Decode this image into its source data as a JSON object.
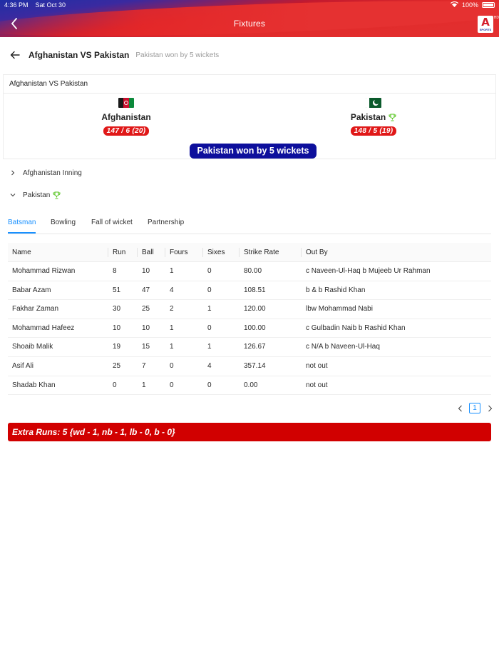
{
  "status_bar": {
    "time": "4:36 PM",
    "date": "Sat Oct 30",
    "battery": "100%"
  },
  "appbar": {
    "title": "Fixtures",
    "logo_letter": "A",
    "logo_text": "SPORTS",
    "logo_badge": "HD"
  },
  "header": {
    "title": "Afghanistan VS Pakistan",
    "subtitle": "Pakistan won by 5 wickets"
  },
  "match": {
    "title": "Afghanistan VS Pakistan",
    "team1": {
      "name": "Afghanistan",
      "score": "147 / 6 (20)"
    },
    "team2": {
      "name": "Pakistan",
      "score": "148 / 5 (19)"
    },
    "result": "Pakistan won by 5 wickets"
  },
  "innings": [
    {
      "label": "Afghanistan Inning",
      "expanded": false
    },
    {
      "label": "Pakistan",
      "expanded": true
    }
  ],
  "tabs": [
    "Batsman",
    "Bowling",
    "Fall of wicket",
    "Partnership"
  ],
  "active_tab": "Batsman",
  "table": {
    "columns": [
      "Name",
      "Run",
      "Ball",
      "Fours",
      "Sixes",
      "Strike Rate",
      "Out By"
    ],
    "rows": [
      [
        "Mohammad Rizwan",
        "8",
        "10",
        "1",
        "0",
        "80.00",
        "c Naveen-Ul-Haq b Mujeeb Ur Rahman"
      ],
      [
        "Babar Azam",
        "51",
        "47",
        "4",
        "0",
        "108.51",
        "b & b Rashid Khan"
      ],
      [
        "Fakhar Zaman",
        "30",
        "25",
        "2",
        "1",
        "120.00",
        "lbw Mohammad Nabi"
      ],
      [
        "Mohammad Hafeez",
        "10",
        "10",
        "1",
        "0",
        "100.00",
        "c Gulbadin Naib b Rashid Khan"
      ],
      [
        "Shoaib Malik",
        "19",
        "15",
        "1",
        "1",
        "126.67",
        "c N/A b Naveen-Ul-Haq"
      ],
      [
        "Asif Ali",
        "25",
        "7",
        "0",
        "4",
        "357.14",
        "not out"
      ],
      [
        "Shadab Khan",
        "0",
        "1",
        "0",
        "0",
        "0.00",
        "not out"
      ]
    ]
  },
  "pagination": {
    "current": "1"
  },
  "extras": "Extra Runs: 5 {wd - 1, nb - 1, lb - 0, b - 0}",
  "colors": {
    "accent": "#1890ff",
    "score_red": "#e01818",
    "result_navy": "#0d0f9c",
    "extras_red": "#d10000",
    "trophy_green": "#52c41a"
  },
  "icons": [
    "back-arrow-icon",
    "wifi-icon",
    "battery-icon",
    "trophy-icon",
    "chevron-right-icon",
    "chevron-down-icon",
    "chevron-left-icon"
  ]
}
